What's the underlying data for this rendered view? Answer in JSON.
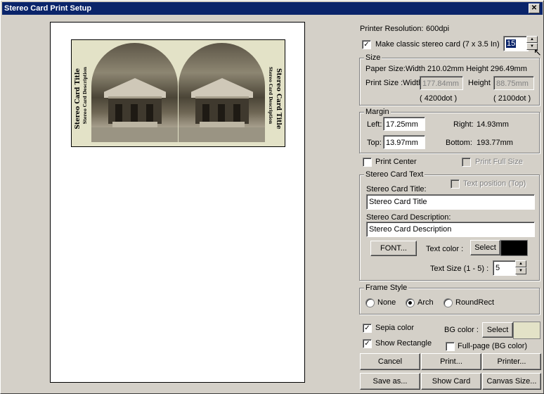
{
  "window": {
    "title": "Stereo Card Print Setup"
  },
  "preview": {
    "card_title": "Stereo Card Title",
    "card_description": "Stereo Card Description"
  },
  "printer": {
    "resolution_label": "Printer Resolution:",
    "resolution_value": "600dpi",
    "classic_label": "Make classic stereo card (7 x 3.5 In)",
    "classic_checked": true,
    "classic_value": "15"
  },
  "size": {
    "title": "Size",
    "paper_size": "Paper Size:Width 210.02mm Height 296.49mm",
    "print_size_width_label": "Print Size :Width",
    "width_value": "177.84mm",
    "height_label": "Height",
    "height_value": "88.75mm",
    "width_dots": "( 4200dot )",
    "height_dots": "( 2100dot )"
  },
  "margin": {
    "title": "Margin",
    "left_label": "Left:",
    "left_value": "17.25mm",
    "top_label": "Top:",
    "top_value": "13.97mm",
    "right_label": "Right:",
    "right_value": "14.93mm",
    "bottom_label": "Bottom:",
    "bottom_value": "193.77mm"
  },
  "options": {
    "print_center": "Print Center",
    "print_full_size": "Print Full Size"
  },
  "text_group": {
    "title": "Stereo Card Text",
    "text_position": "Text position (Top)",
    "card_title_label": "Stereo Card Title:",
    "card_title_value": "Stereo Card Title",
    "card_desc_label": "Stereo Card Description:",
    "card_desc_value": "Stereo Card Description",
    "font_button": "FONT...",
    "text_color_label": "Text color :",
    "select_button": "Select",
    "text_size_label": "Text Size (1 - 5) :",
    "text_size_value": "5",
    "text_color": "#000000"
  },
  "frame": {
    "title": "Frame Style",
    "options": [
      "None",
      "Arch",
      "RoundRect"
    ],
    "selected": "Arch"
  },
  "appearance": {
    "sepia_label": "Sepia color",
    "show_rect_label": "Show Rectangle",
    "bg_color_label": "BG color :",
    "select_button": "Select",
    "full_page_label": "Full-page (BG color)",
    "bg_color": "#e3e2c7"
  },
  "buttons": {
    "cancel": "Cancel",
    "print": "Print...",
    "printer": "Printer...",
    "save_as": "Save as...",
    "show_card": "Show Card",
    "canvas_size": "Canvas Size..."
  }
}
